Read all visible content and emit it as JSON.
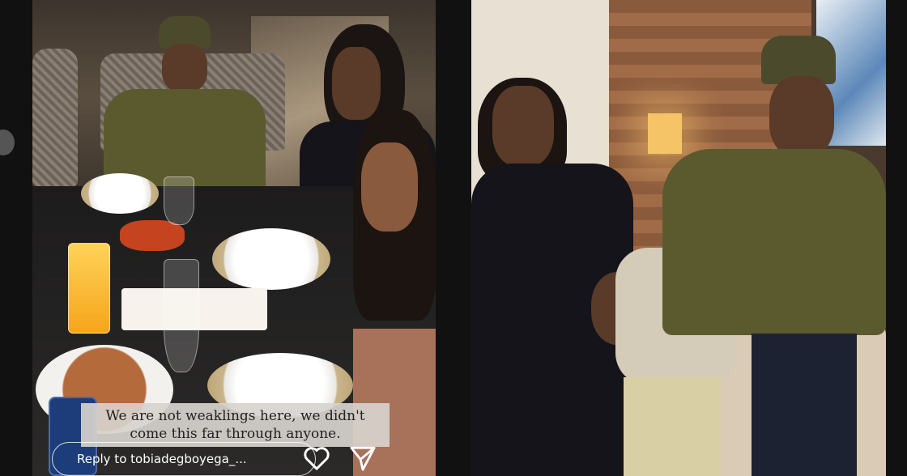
{
  "left_panel": {
    "caption_line1": "We are not weaklings here, we didn't",
    "caption_line2": "come this far through anyone.",
    "reply_placeholder": "Reply to tobiadegboyega_...",
    "like_icon": "heart-icon",
    "share_icon": "send-icon"
  },
  "right_panel": {},
  "colors": {
    "caption_bg": "#d7d2cd",
    "caption_text": "#222222",
    "reply_border": "#ffffff"
  }
}
